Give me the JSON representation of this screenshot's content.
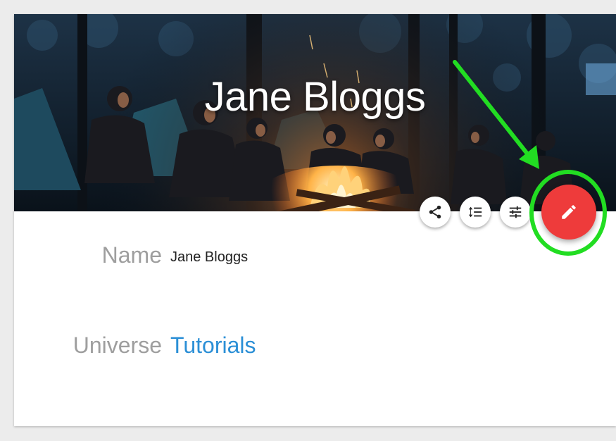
{
  "profile": {
    "title": "Jane Bloggs",
    "fields": {
      "name": {
        "label": "Name",
        "value": "Jane Bloggs"
      },
      "universe": {
        "label": "Universe",
        "value": "Tutorials"
      }
    }
  },
  "actions": [
    {
      "name": "share",
      "icon": "share-icon"
    },
    {
      "name": "sort",
      "icon": "format-line-spacing-icon"
    },
    {
      "name": "filters",
      "icon": "tune-icon"
    },
    {
      "name": "edit",
      "icon": "pencil-icon"
    }
  ],
  "colors": {
    "edit_fab": "#ee3b3b",
    "link": "#2b8fd6",
    "label": "#9e9e9e",
    "annotation": "#22dd22"
  }
}
